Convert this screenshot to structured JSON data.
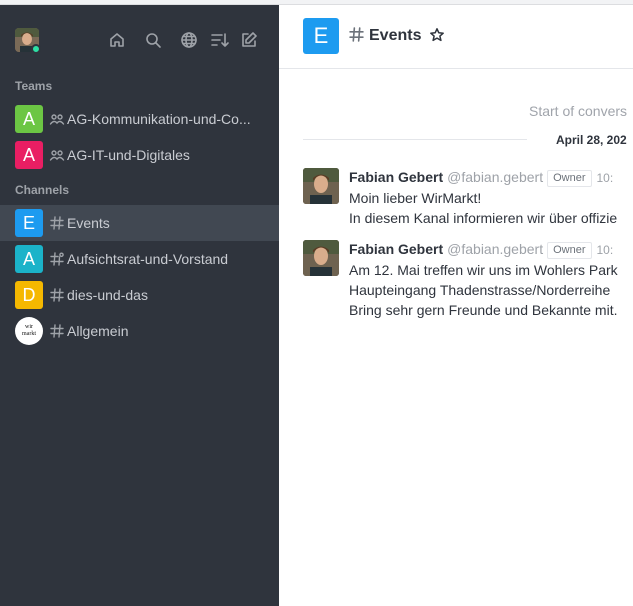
{
  "sidebar": {
    "user": {
      "status": "online"
    },
    "header_icons": [
      "home-icon",
      "search-icon",
      "globe-icon",
      "sort-icon",
      "edit-icon"
    ],
    "teams_title": "Teams",
    "teams": [
      {
        "avatar_letter": "A",
        "avatar_color": "#6cc644",
        "label": "AG-Kommunikation-und-Co..."
      },
      {
        "avatar_letter": "A",
        "avatar_color": "#e91e63",
        "label": "AG-IT-und-Digitales"
      }
    ],
    "channels_title": "Channels",
    "channels": [
      {
        "avatar_letter": "E",
        "avatar_color": "#1d9bf0",
        "label": "Events",
        "active": true
      },
      {
        "avatar_letter": "A",
        "avatar_color": "#1bb3c9",
        "label": "Aufsichtsrat-und-Vorstand"
      },
      {
        "avatar_letter": "D",
        "avatar_color": "#f5b800",
        "label": "dies-und-das"
      },
      {
        "avatar_logo": "wir markt",
        "label": "Allgemein"
      }
    ]
  },
  "room": {
    "avatar_letter": "E",
    "avatar_color": "#1d9bf0",
    "title": "Events",
    "start_text": "Start of convers",
    "date": "April 28, 202"
  },
  "messages": [
    {
      "name": "Fabian Gebert",
      "username": "@fabian.gebert",
      "role": "Owner",
      "time": "10:",
      "lines": [
        "Moin lieber WirMarkt!",
        "In diesem Kanal informieren wir über offizie"
      ]
    },
    {
      "name": "Fabian Gebert",
      "username": "@fabian.gebert",
      "role": "Owner",
      "time": "10:",
      "lines": [
        "Am 12. Mai treffen wir uns im Wohlers Park",
        "Haupteingang Thadenstrasse/Norderreihe",
        "Bring sehr gern Freunde und Bekannte mit."
      ]
    }
  ]
}
